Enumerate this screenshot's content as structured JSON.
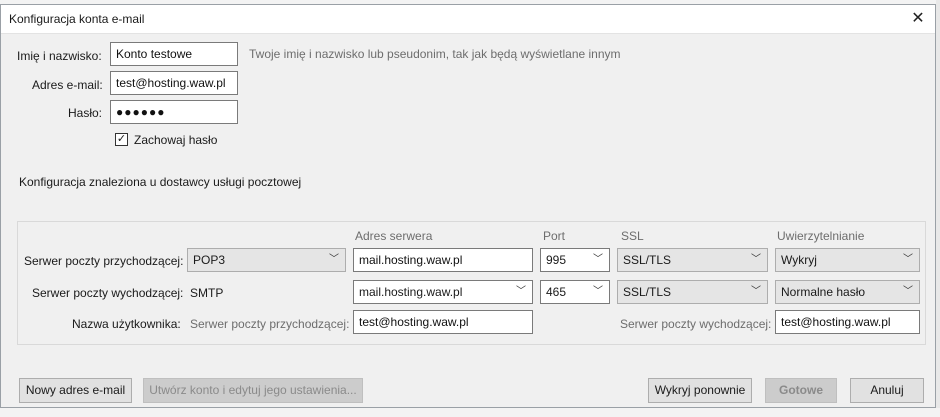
{
  "window": {
    "title": "Konfiguracja konta e-mail",
    "close_glyph": "✕"
  },
  "form": {
    "name_label": "Imię i nazwisko:",
    "name_value": "Konto testowe",
    "name_hint": "Twoje imię i nazwisko lub pseudonim, tak jak będą wyświetlane innym",
    "email_label": "Adres e-mail:",
    "email_value": "test@hosting.waw.pl",
    "password_label": "Hasło:",
    "password_value": "●●●●●●",
    "remember_label": "Zachowaj hasło",
    "remember_checked": true
  },
  "status_text": "Konfiguracja znaleziona u dostawcy usługi pocztowej",
  "servers": {
    "headers": {
      "address": "Adres serwera",
      "port": "Port",
      "ssl": "SSL",
      "auth": "Uwierzytelnianie"
    },
    "incoming": {
      "label": "Serwer poczty przychodzącej:",
      "protocol": "POP3",
      "address": "mail.hosting.waw.pl",
      "port": "995",
      "ssl": "SSL/TLS",
      "auth": "Wykryj"
    },
    "outgoing": {
      "label": "Serwer poczty wychodzącej:",
      "protocol": "SMTP",
      "address": "mail.hosting.waw.pl",
      "port": "465",
      "ssl": "SSL/TLS",
      "auth": "Normalne hasło"
    },
    "username": {
      "label": "Nazwa użytkownika:",
      "incoming_label": "Serwer poczty przychodzącej:",
      "incoming_value": "test@hosting.waw.pl",
      "outgoing_label": "Serwer poczty wychodzącej:",
      "outgoing_value": "test@hosting.waw.pl"
    }
  },
  "buttons": {
    "new_address": "Nowy adres e-mail",
    "manual_config": "Utwórz konto i edytuj jego ustawienia...",
    "redetect": "Wykryj ponownie",
    "done": "Gotowe",
    "cancel": "Anuluj"
  },
  "icons": {
    "chevron": "﹀",
    "check": "✓"
  }
}
